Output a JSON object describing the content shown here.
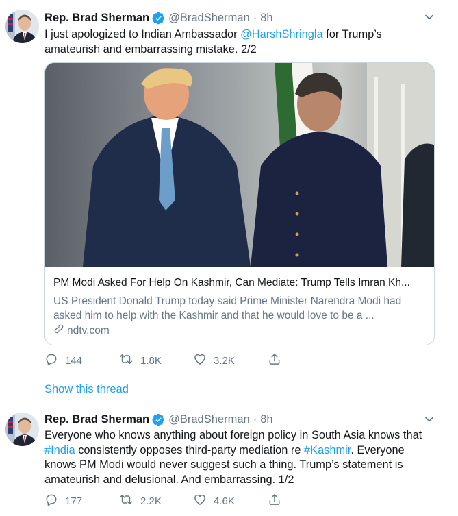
{
  "tweets": [
    {
      "author": "Rep. Brad Sherman",
      "handle": "@BradSherman",
      "separator": "·",
      "time": "8h",
      "text": {
        "before": "I just apologized to Indian Ambassador ",
        "mention": "@HarshShringla",
        "after": " for Trump’s amateurish and embarrassing mistake. 2/2"
      },
      "card": {
        "title": "PM Modi Asked For Help On Kashmir, Can Mediate: Trump Tells Imran Kh...",
        "description": "US President Donald Trump today said Prime Minister Narendra Modi had asked him to help with the Kashmir and that he would love to be a ...",
        "domain": "ndtv.com"
      },
      "actions": {
        "replies": "144",
        "retweets": "1.8K",
        "likes": "3.2K"
      },
      "show_thread": "Show this thread"
    },
    {
      "author": "Rep. Brad Sherman",
      "handle": "@BradSherman",
      "separator": "·",
      "time": "8h",
      "text": {
        "p1": "Everyone who knows anything about foreign policy in South Asia knows that ",
        "hashtag1": "#India",
        "p2": " consistently opposes third-party mediation re ",
        "hashtag2": "#Kashmir",
        "p3": ". Everyone knows PM Modi would never suggest such a thing. Trump’s statement is amateurish and delusional. And embarrassing. 1/2"
      },
      "actions": {
        "replies": "177",
        "retweets": "2.2K",
        "likes": "4.6K"
      }
    }
  ],
  "icons": {
    "verified": "verified-badge-icon",
    "caret": "chevron-down-icon",
    "reply": "reply-icon",
    "retweet": "retweet-icon",
    "like": "heart-icon",
    "share": "share-icon",
    "link": "link-icon"
  },
  "colors": {
    "accent": "#1da1f2",
    "secondary_text": "#657786",
    "primary_text": "#14171a",
    "border": "#e6ecf0"
  }
}
